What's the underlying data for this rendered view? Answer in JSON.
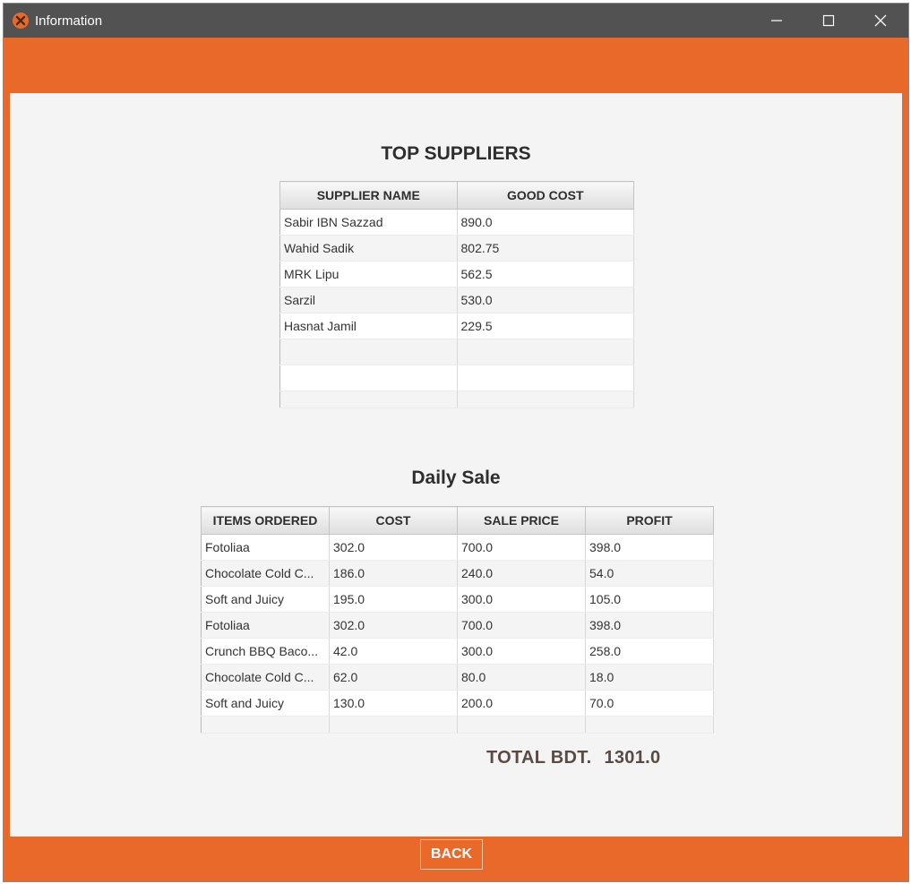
{
  "window": {
    "title": "Information"
  },
  "suppliers": {
    "title": "TOP SUPPLIERS",
    "columns": [
      "SUPPLIER NAME",
      "GOOD COST"
    ],
    "rows": [
      [
        "Sabir IBN Sazzad",
        "890.0"
      ],
      [
        "Wahid Sadik",
        "802.75"
      ],
      [
        "MRK Lipu",
        "562.5"
      ],
      [
        "Sarzil",
        "530.0"
      ],
      [
        "Hasnat Jamil",
        "229.5"
      ]
    ]
  },
  "daily_sale": {
    "title": "Daily Sale",
    "columns": [
      "ITEMS ORDERED",
      "COST",
      "SALE PRICE",
      "PROFIT"
    ],
    "rows": [
      [
        "Fotoliaa",
        "302.0",
        "700.0",
        "398.0"
      ],
      [
        "Chocolate Cold C...",
        "186.0",
        "240.0",
        "54.0"
      ],
      [
        "Soft and Juicy",
        "195.0",
        "300.0",
        "105.0"
      ],
      [
        "Fotoliaa",
        "302.0",
        "700.0",
        "398.0"
      ],
      [
        "Crunch BBQ Baco...",
        "42.0",
        "300.0",
        "258.0"
      ],
      [
        "Chocolate Cold C...",
        "62.0",
        "80.0",
        "18.0"
      ],
      [
        "Soft and Juicy",
        "130.0",
        "200.0",
        "70.0"
      ]
    ]
  },
  "total": {
    "label": "TOTAL BDT.",
    "value": "1301.0"
  },
  "back_button": {
    "label": "BACK"
  },
  "colors": {
    "accent": "#e8692a",
    "titlebar": "#525252",
    "content_bg": "#f4f4f4"
  }
}
